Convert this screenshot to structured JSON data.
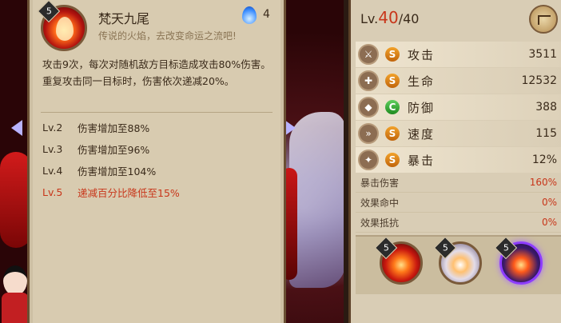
{
  "skill": {
    "level_badge": "5",
    "name": "梵天九尾",
    "subtitle": "传说的火焰，去改变命运之流吧!",
    "cost": "4",
    "desc_line1": "攻击9次，每次对随机敌方目标造成攻击80%伤害。",
    "desc_line2": "重复攻击同一目标时，伤害依次递减20%。",
    "levels": [
      {
        "tag": "Lv.2",
        "text": "伤害增加至88%"
      },
      {
        "tag": "Lv.3",
        "text": "伤害增加至96%"
      },
      {
        "tag": "Lv.4",
        "text": "伤害增加至104%"
      },
      {
        "tag": "Lv.5",
        "text": "递减百分比降低至15%"
      }
    ]
  },
  "profile": {
    "lv_prefix": "Lv.",
    "lv_current": "40",
    "lv_max": "/40"
  },
  "stats": [
    {
      "icon": "attack-icon",
      "grade": "S",
      "name": "攻击",
      "value": "3511"
    },
    {
      "icon": "health-icon",
      "grade": "S",
      "name": "生命",
      "value": "12532"
    },
    {
      "icon": "defense-icon",
      "grade": "C",
      "name": "防御",
      "value": "388"
    },
    {
      "icon": "speed-icon",
      "grade": "S",
      "name": "速度",
      "value": "115"
    },
    {
      "icon": "crit-icon",
      "grade": "S",
      "name": "暴击",
      "value": "12%"
    }
  ],
  "sub_stats": [
    {
      "name": "暴击伤害",
      "value": "160%"
    },
    {
      "name": "效果命中",
      "value": "0%"
    },
    {
      "name": "效果抵抗",
      "value": "0%"
    }
  ],
  "souls": [
    {
      "badge": "5"
    },
    {
      "badge": "5"
    },
    {
      "badge": "5"
    }
  ],
  "colors": {
    "accent_red": "#c8361a",
    "grade_gold": "#e08a1a",
    "grade_green": "#2fa82f",
    "panel_bg": "#d8cbb0"
  }
}
